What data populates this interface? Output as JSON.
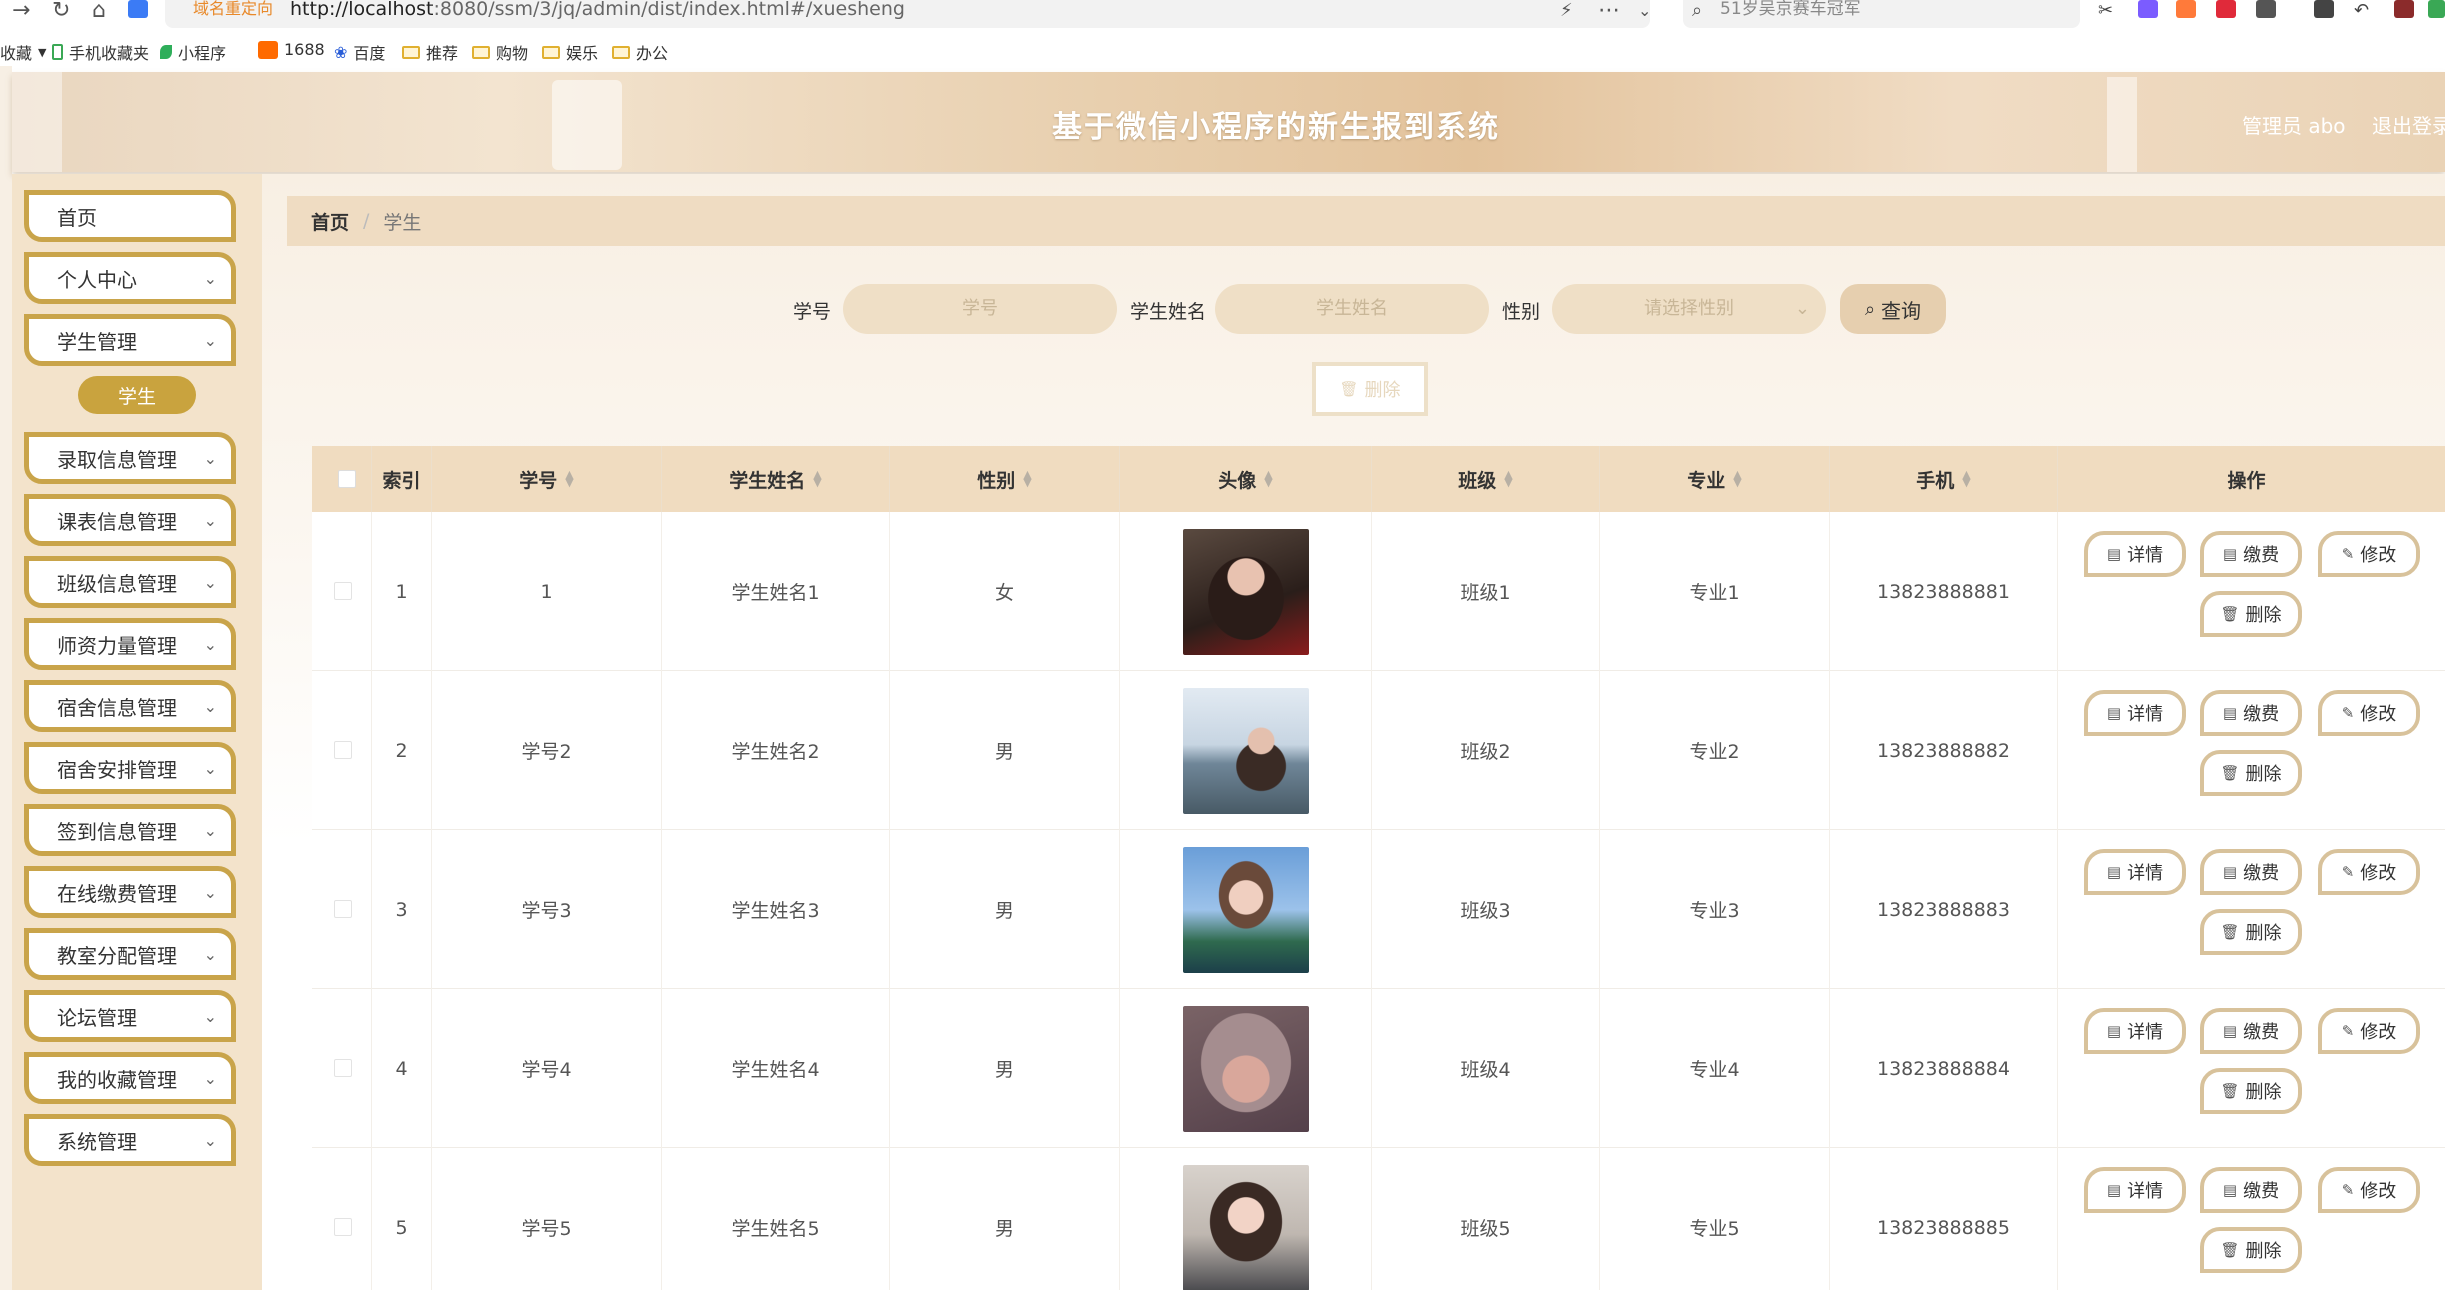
{
  "browser": {
    "url_redirect": "域名重定向",
    "url_host": "http://localhost",
    "url_path": ":8080/ssm/3/jq/admin/dist/index.html#/xuesheng",
    "search_text": "51岁吴京赛车冠军"
  },
  "bookmarks": [
    {
      "label": "收藏"
    },
    {
      "label": "手机收藏夹"
    },
    {
      "label": "小程序"
    },
    {
      "label": "1688"
    },
    {
      "label": "百度"
    },
    {
      "label": "推荐"
    },
    {
      "label": "购物"
    },
    {
      "label": "娱乐"
    },
    {
      "label": "办公"
    }
  ],
  "header": {
    "title": "基于微信小程序的新生报到系统",
    "admin": "管理员 abo",
    "logout": "退出登录"
  },
  "sidebar": {
    "items": [
      {
        "label": "首页"
      },
      {
        "label": "个人中心"
      },
      {
        "label": "学生管理"
      },
      {
        "label": "录取信息管理"
      },
      {
        "label": "课表信息管理"
      },
      {
        "label": "班级信息管理"
      },
      {
        "label": "师资力量管理"
      },
      {
        "label": "宿舍信息管理"
      },
      {
        "label": "宿舍安排管理"
      },
      {
        "label": "签到信息管理"
      },
      {
        "label": "在线缴费管理"
      },
      {
        "label": "教室分配管理"
      },
      {
        "label": "论坛管理"
      },
      {
        "label": "我的收藏管理"
      },
      {
        "label": "系统管理"
      }
    ],
    "active_sub": "学生"
  },
  "breadcrumb": {
    "home": "首页",
    "sep": "/",
    "current": "学生"
  },
  "search": {
    "xuehao_label": "学号",
    "xuehao_placeholder": "学号",
    "name_label": "学生姓名",
    "name_placeholder": "学生姓名",
    "gender_label": "性别",
    "gender_placeholder": "请选择性别",
    "query_button": "查询"
  },
  "toolbar": {
    "delete_button": "删除"
  },
  "table": {
    "headers": [
      "索引",
      "学号",
      "学生姓名",
      "性别",
      "头像",
      "班级",
      "专业",
      "手机",
      "操作"
    ],
    "rows": [
      {
        "index": "1",
        "xuehao": "1",
        "name": "学生姓名1",
        "gender": "女",
        "banji": "班级1",
        "zhuanye": "专业1",
        "phone": "13823888881"
      },
      {
        "index": "2",
        "xuehao": "学号2",
        "name": "学生姓名2",
        "gender": "男",
        "banji": "班级2",
        "zhuanye": "专业2",
        "phone": "13823888882"
      },
      {
        "index": "3",
        "xuehao": "学号3",
        "name": "学生姓名3",
        "gender": "男",
        "banji": "班级3",
        "zhuanye": "专业3",
        "phone": "13823888883"
      },
      {
        "index": "4",
        "xuehao": "学号4",
        "name": "学生姓名4",
        "gender": "男",
        "banji": "班级4",
        "zhuanye": "专业4",
        "phone": "13823888884"
      },
      {
        "index": "5",
        "xuehao": "学号5",
        "name": "学生姓名5",
        "gender": "男",
        "banji": "班级5",
        "zhuanye": "专业5",
        "phone": "13823888885"
      }
    ],
    "actions": {
      "detail": "详情",
      "pay": "缴费",
      "edit": "修改",
      "delete": "删除"
    }
  },
  "colors": {
    "accent": "#c9a44a",
    "header_bg": "#f0dcc0",
    "sidebar_bg": "#f3e3cb"
  }
}
